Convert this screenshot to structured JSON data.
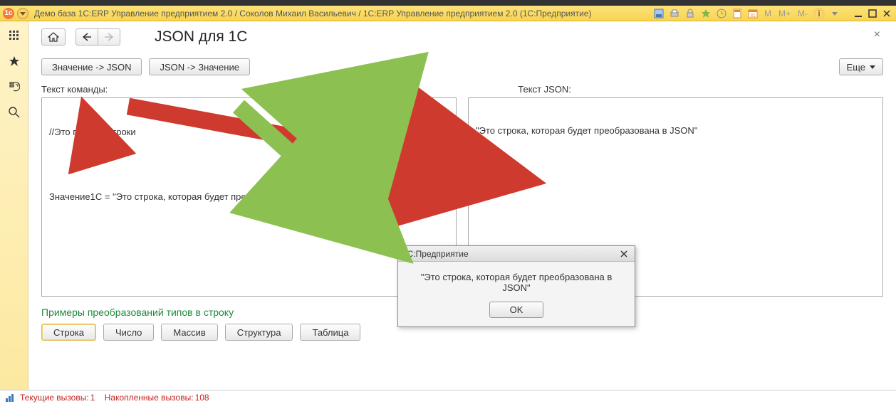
{
  "window": {
    "title": "Демо база 1С:ERP Управление предприятием 2.0 / Соколов Михаил Васильевич / 1C:ERP Управление предприятием 2.0  (1С:Предприятие)",
    "m_labels": [
      "M",
      "M+",
      "M-"
    ]
  },
  "page": {
    "title": "JSON для 1С",
    "val_to_json": "Значение -> JSON",
    "json_to_val": "JSON -> Значение",
    "more": "Еще",
    "left_label": "Текст команды:",
    "right_label": "Текст JSON:",
    "left_code_line1": "//Это пример строки",
    "left_code_line2": "Значение1С = \"Это строка, которая будет преобразована в JSON\";",
    "right_text": "\"Это строка, которая будет преобразована в JSON\"",
    "section": "Примеры преобразований типов в строку",
    "types": {
      "string": "Строка",
      "number": "Число",
      "array": "Массив",
      "struct": "Структура",
      "table": "Таблица"
    }
  },
  "dialog": {
    "title": "1С:Предприятие",
    "body": "\"Это строка, которая будет преобразована в JSON\"",
    "ok": "OK"
  },
  "status": {
    "current_label": "Текущие вызовы:",
    "current_value": "1",
    "accum_label": "Накопленные вызовы:",
    "accum_value": "108"
  }
}
